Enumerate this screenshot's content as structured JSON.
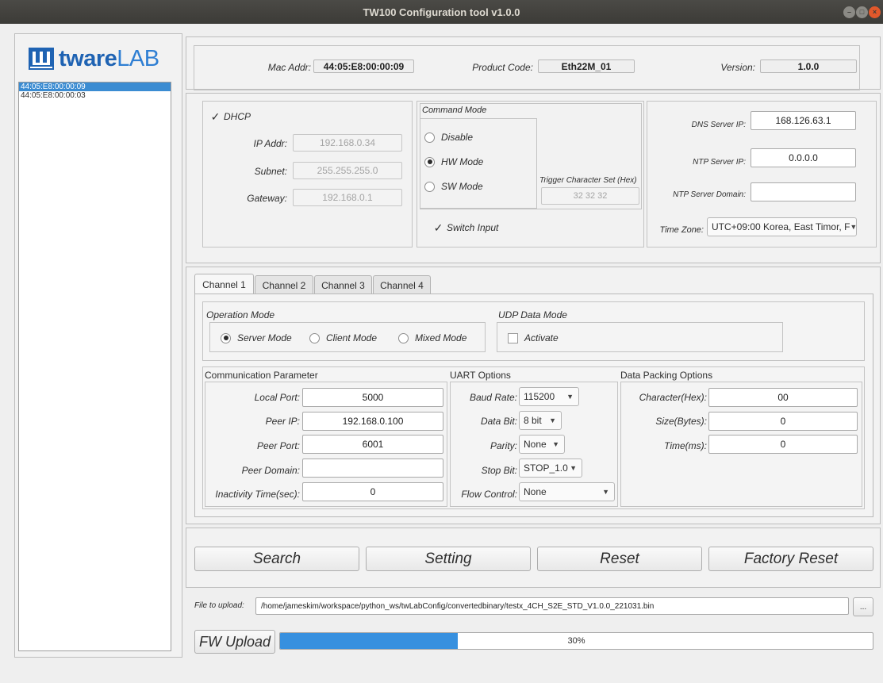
{
  "window": {
    "title": "TW100 Configuration tool v1.0.0"
  },
  "logo": {
    "part1": "tware",
    "part2": "LAB"
  },
  "device_list": [
    "44:05:E8:00:00:09",
    "44:05:E8:00:00:03"
  ],
  "device_info": {
    "mac_label": "Mac Addr:",
    "mac_value": "44:05:E8:00:00:09",
    "product_label": "Product Code:",
    "product_value": "Eth22M_01",
    "version_label": "Version:",
    "version_value": "1.0.0"
  },
  "network": {
    "dhcp_label": "DHCP",
    "ip_label": "IP Addr:",
    "ip_value": "192.168.0.34",
    "subnet_label": "Subnet:",
    "subnet_value": "255.255.255.0",
    "gateway_label": "Gateway:",
    "gateway_value": "192.168.0.1"
  },
  "command": {
    "title": "Command Mode",
    "disable": "Disable",
    "hw": "HW Mode",
    "sw": "SW Mode",
    "selected": "HW Mode",
    "trigger_label": "Trigger Character Set (Hex)",
    "trigger_value": "32 32 32",
    "switch_input": "Switch Input"
  },
  "server": {
    "dns_label": "DNS Server IP:",
    "dns_value": "168.126.63.1",
    "ntp_label": "NTP Server IP:",
    "ntp_value": "0.0.0.0",
    "ntp_domain_label": "NTP Server Domain:",
    "ntp_domain_value": "",
    "tz_label": "Time Zone:",
    "tz_value": "UTC+09:00 Korea, East Timor, F"
  },
  "tabs": [
    "Channel 1",
    "Channel 2",
    "Channel 3",
    "Channel 4"
  ],
  "operation": {
    "title": "Operation Mode",
    "server": "Server Mode",
    "client": "Client Mode",
    "mixed": "Mixed Mode",
    "selected": "Server Mode",
    "udp_title": "UDP Data Mode",
    "activate": "Activate"
  },
  "comm": {
    "title": "Communication Parameter",
    "local_port_label": "Local Port:",
    "local_port": "5000",
    "peer_ip_label": "Peer IP:",
    "peer_ip": "192.168.0.100",
    "peer_port_label": "Peer Port:",
    "peer_port": "6001",
    "peer_domain_label": "Peer Domain:",
    "peer_domain": "",
    "inactivity_label": "Inactivity Time(sec):",
    "inactivity": "0"
  },
  "uart": {
    "title": "UART Options",
    "baud_label": "Baud Rate:",
    "baud": "115200",
    "databit_label": "Data Bit:",
    "databit": "8 bit",
    "parity_label": "Parity:",
    "parity": "None",
    "stopbit_label": "Stop Bit:",
    "stopbit": "STOP_1.0",
    "flow_label": "Flow Control:",
    "flow": "None"
  },
  "packing": {
    "title": "Data Packing Options",
    "char_label": "Character(Hex):",
    "char": "00",
    "size_label": "Size(Bytes):",
    "size": "0",
    "time_label": "Time(ms):",
    "time": "0"
  },
  "actions": {
    "search": "Search",
    "setting": "Setting",
    "reset": "Reset",
    "factory": "Factory Reset"
  },
  "upload": {
    "file_label": "File to upload:",
    "file_path": "/home/jameskim/workspace/python_ws/twLabConfig/convertedbinary/testx_4CH_S2E_STD_V1.0.0_221031.bin",
    "browse": "...",
    "fw_button": "FW Upload",
    "progress_text": "30%",
    "progress": 0.3
  },
  "colors": {
    "accent": "#3790df",
    "logo": "#1f63b3",
    "selection": "#3b8cd2"
  }
}
